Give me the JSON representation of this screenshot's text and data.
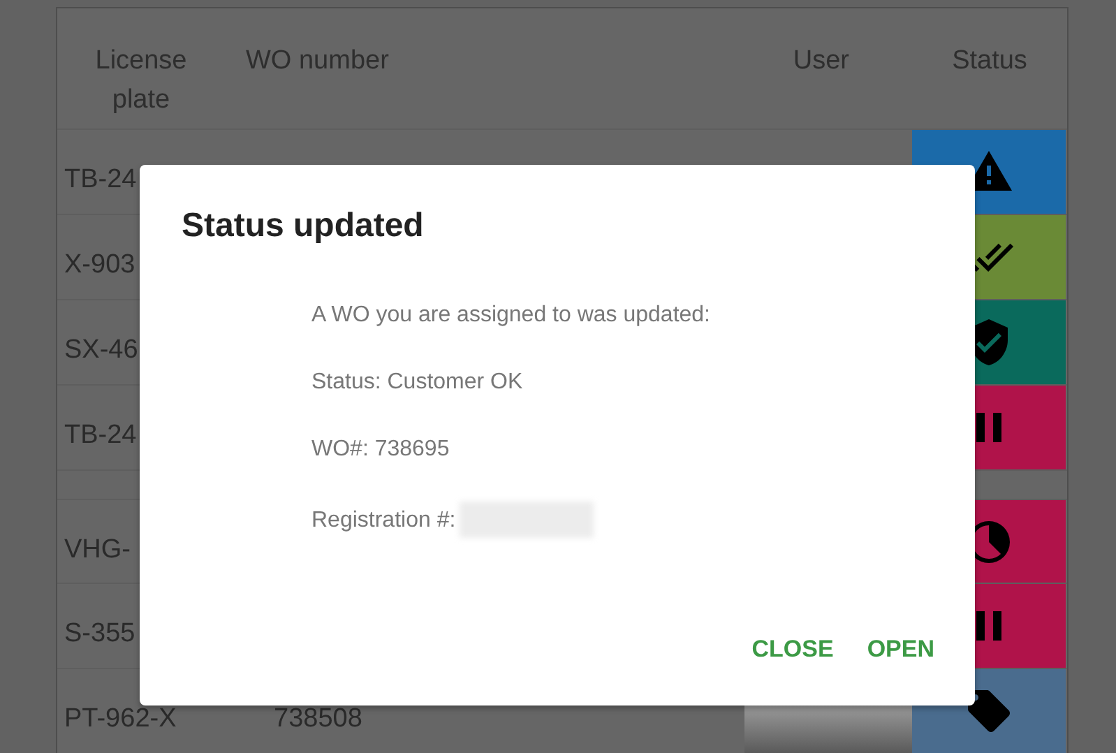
{
  "table": {
    "columns": [
      "License plate",
      "WO number",
      "User",
      "Status"
    ],
    "rows": [
      {
        "plate": "TB-24",
        "wo": "",
        "kind": "warning",
        "color": "#1b6aa9",
        "section_break": false
      },
      {
        "plate": "X-903",
        "wo": "",
        "kind": "double-check",
        "color": "#6a8a36",
        "section_break": false
      },
      {
        "plate": "SX-46",
        "wo": "",
        "kind": "shield-check",
        "color": "#0a6a5c",
        "section_break": false
      },
      {
        "plate": "TB-24",
        "wo": "",
        "kind": "pause",
        "color": "#b0134a",
        "section_break": false
      },
      {
        "plate": "VHG-",
        "wo": "",
        "kind": "clock",
        "color": "#b0134a",
        "section_break": true
      },
      {
        "plate": "S-355",
        "wo": "",
        "kind": "pause",
        "color": "#b0134a",
        "section_break": false
      },
      {
        "plate": "PT-962-X",
        "wo": "738508",
        "kind": "tag",
        "color": "#4a6c8e",
        "redacted": true,
        "section_break": false
      }
    ]
  },
  "dialog": {
    "title": "Status updated",
    "lines": [
      {
        "text": "A WO you are assigned to was updated:",
        "redacted": false
      },
      {
        "text": "Status: Customer OK",
        "redacted": false
      },
      {
        "text": "WO#: 738695",
        "redacted": false
      },
      {
        "text": "Registration #:",
        "redacted": true
      }
    ],
    "buttons": [
      "CLOSE",
      "OPEN"
    ]
  }
}
